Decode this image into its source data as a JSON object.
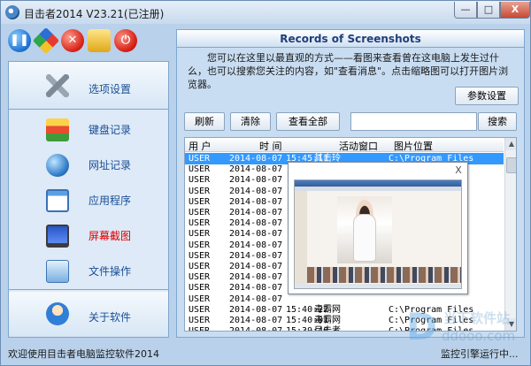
{
  "window": {
    "title": "目击者2014 V23.21(已注册)",
    "buttons": {
      "minimize": "—",
      "maximize": "□",
      "close": "X"
    }
  },
  "toolbar": {
    "icons": [
      "pause-icon",
      "color-picker-icon",
      "stop-icon",
      "users-icon",
      "power-icon"
    ]
  },
  "sidebar": {
    "items": [
      {
        "label": "选项设置",
        "icon": "wrench-icon"
      },
      {
        "label": "键盘记录",
        "icon": "keyboard-icon"
      },
      {
        "label": "网址记录",
        "icon": "globe-icon"
      },
      {
        "label": "应用程序",
        "icon": "application-icon"
      },
      {
        "label": "屏幕截图",
        "icon": "monitor-icon",
        "active": true
      },
      {
        "label": "文件操作",
        "icon": "folder-icon"
      },
      {
        "label": "关于软件",
        "icon": "people-icon"
      }
    ]
  },
  "panel": {
    "title": "Records of Screenshots",
    "description": "您可以在这里以最直观的方式——看图来查看曾在这电脑上发生过什么，也可以搜索您关注的内容，如\"查看消息\"。点击缩略图可以打开图片浏览器。",
    "settings_button": "参数设置",
    "refresh_button": "刷新",
    "clear_button": "清除",
    "view_all_button": "查看全部",
    "search_value": "",
    "search_button": "搜索"
  },
  "table": {
    "columns": [
      "用 户",
      "时    间",
      "活动窗口",
      "图片位置"
    ],
    "rows": [
      [
        "USER",
        "2014-08-07",
        "15:45:11",
        "其击玲",
        "C:\\Program Files"
      ],
      [
        "USER",
        "2014-08-07",
        "",
        "",
        ""
      ],
      [
        "USER",
        "2014-08-07",
        "",
        "",
        ""
      ],
      [
        "USER",
        "2014-08-07",
        "",
        "",
        ""
      ],
      [
        "USER",
        "2014-08-07",
        "",
        "",
        ""
      ],
      [
        "USER",
        "2014-08-07",
        "",
        "",
        ""
      ],
      [
        "USER",
        "2014-08-07",
        "",
        "",
        ""
      ],
      [
        "USER",
        "2014-08-07",
        "",
        "",
        ""
      ],
      [
        "USER",
        "2014-08-07",
        "",
        "",
        ""
      ],
      [
        "USER",
        "2014-08-07",
        "",
        "",
        ""
      ],
      [
        "USER",
        "2014-08-07",
        "",
        "",
        ""
      ],
      [
        "USER",
        "2014-08-07",
        "",
        "",
        ""
      ],
      [
        "USER",
        "2014-08-07",
        "",
        "",
        ""
      ],
      [
        "USER",
        "2014-08-07",
        "",
        "",
        ""
      ],
      [
        "USER",
        "2014-08-07",
        "15:40:22",
        "毒霸网",
        "C:\\Program Files"
      ],
      [
        "USER",
        "2014-08-07",
        "15:40:01",
        "毒霸网",
        "C:\\Program Files"
      ],
      [
        "USER",
        "2014-08-07",
        "15:39:40",
        "目击者",
        "C:\\Program Files"
      ]
    ],
    "selected_row": 0
  },
  "popup": {
    "close": "X"
  },
  "status": {
    "left": "欢迎使用目击者电脑监控软件2014",
    "right": "监控引擎运行中..."
  },
  "watermark": {
    "mark": "D",
    "text": "当下软件站",
    "url": "ddooo.com"
  },
  "colors": {
    "window_bg": "#b9d1ea",
    "selected_row": "#3399ff",
    "active_nav": "#e00000",
    "nav_text": "#1a4f95"
  }
}
